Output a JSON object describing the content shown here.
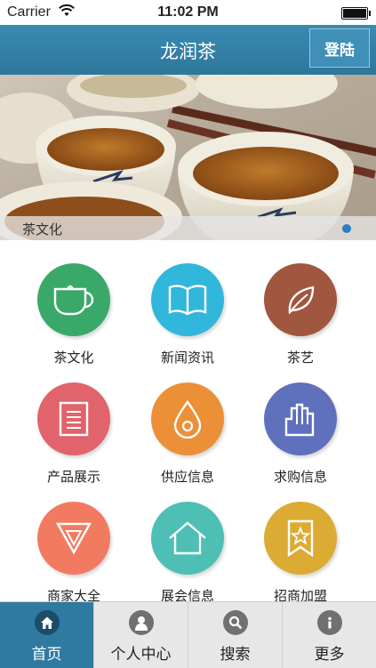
{
  "status_bar": {
    "carrier": "Carrier",
    "time": "11:02 PM"
  },
  "navbar": {
    "title": "龙润茶",
    "login_label": "登陆"
  },
  "banner": {
    "caption": "茶文化",
    "page_count": 1,
    "active_page": 1
  },
  "grid": {
    "items": [
      {
        "label": "茶文化",
        "color": "#3aa869",
        "icon": "teapot-icon"
      },
      {
        "label": "新闻资讯",
        "color": "#31b6dc",
        "icon": "open-book-icon"
      },
      {
        "label": "茶艺",
        "color": "#a0563f",
        "icon": "tea-leaf-icon"
      },
      {
        "label": "产品展示",
        "color": "#e1636b",
        "icon": "document-icon"
      },
      {
        "label": "供应信息",
        "color": "#eb9036",
        "icon": "drop-icon"
      },
      {
        "label": "求购信息",
        "color": "#5f70bd",
        "icon": "hand-icon"
      },
      {
        "label": "商家大全",
        "color": "#f27a61",
        "icon": "triangle-badge-icon"
      },
      {
        "label": "展会信息",
        "color": "#4dbfb4",
        "icon": "house-icon"
      },
      {
        "label": "招商加盟",
        "color": "#dcab33",
        "icon": "bookmark-star-icon"
      }
    ]
  },
  "tabbar": {
    "tabs": [
      {
        "label": "首页",
        "icon": "home-icon",
        "active": true
      },
      {
        "label": "个人中心",
        "icon": "user-icon",
        "active": false
      },
      {
        "label": "搜索",
        "icon": "search-icon",
        "active": false
      },
      {
        "label": "更多",
        "icon": "info-icon",
        "active": false
      }
    ]
  }
}
